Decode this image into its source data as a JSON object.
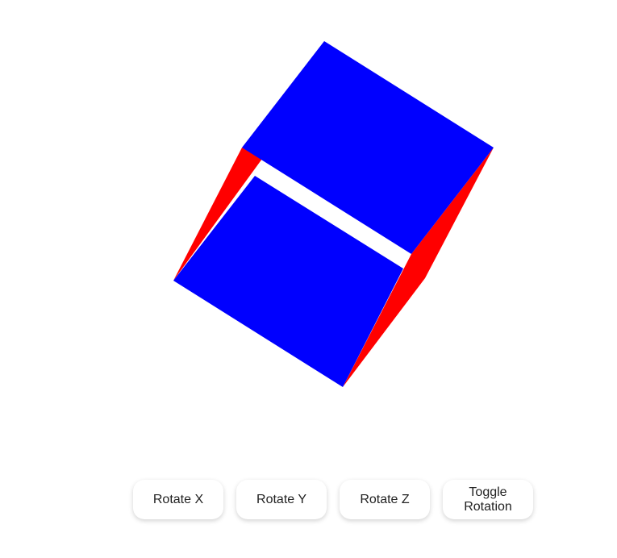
{
  "colors": {
    "face_primary": "#0000ff",
    "face_secondary": "#ff0000",
    "background": "#ffffff"
  },
  "controls": {
    "rotate_x_label": "Rotate X",
    "rotate_y_label": "Rotate Y",
    "rotate_z_label": "Rotate Z",
    "toggle_rotation_label": "Toggle Rotation"
  }
}
